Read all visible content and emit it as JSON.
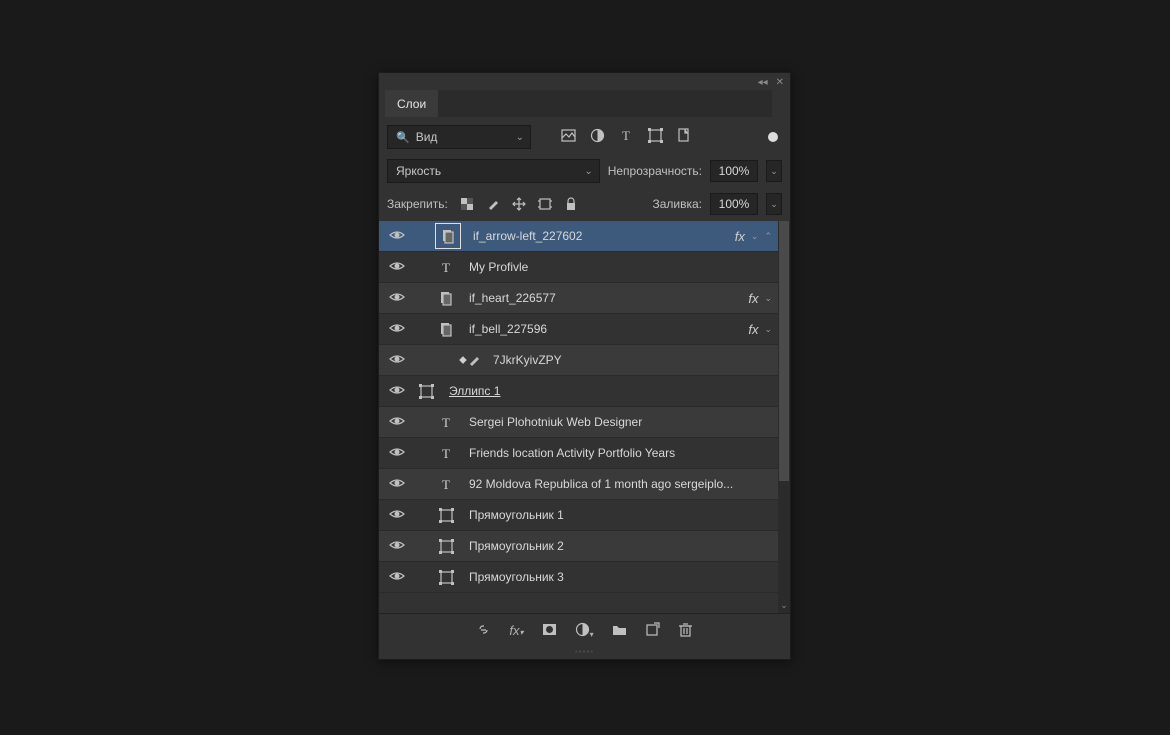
{
  "tab": "Слои",
  "filter": {
    "kind": "Вид"
  },
  "blend": {
    "mode": "Яркость",
    "opacityLabel": "Непрозрачность:",
    "opacity": "100%"
  },
  "lock": {
    "label": "Закрепить:",
    "fillLabel": "Заливка:",
    "fill": "100%"
  },
  "fx": "fx",
  "layers": [
    {
      "name": "if_arrow-left_227602",
      "type": "smart",
      "selected": true,
      "fx": true,
      "indent": 1,
      "collapse": true
    },
    {
      "name": "My Profivle",
      "type": "text",
      "indent": 1
    },
    {
      "name": "if_heart_226577",
      "type": "smart",
      "fx": true,
      "indent": 1,
      "alt": true
    },
    {
      "name": "if_bell_227596",
      "type": "smart",
      "fx": true,
      "indent": 1
    },
    {
      "name": "7JkrKyivZPY",
      "type": "brush",
      "indent": 2,
      "alt": true
    },
    {
      "name": "Эллипс 1",
      "type": "shape",
      "underline": true
    },
    {
      "name": "Sergei Plohotniuk Web Designer",
      "type": "text",
      "indent": 1,
      "alt": true
    },
    {
      "name": "Friends location Activity Portfolio Years",
      "type": "text",
      "indent": 1
    },
    {
      "name": "92 Moldova Republica of 1 month ago sergeiplo...",
      "type": "text",
      "indent": 1,
      "alt": true
    },
    {
      "name": "Прямоугольник 1",
      "type": "shape",
      "indent": 1
    },
    {
      "name": "Прямоугольник 2",
      "type": "shape",
      "indent": 1,
      "alt": true
    },
    {
      "name": "Прямоугольник 3",
      "type": "shape",
      "indent": 1
    }
  ]
}
